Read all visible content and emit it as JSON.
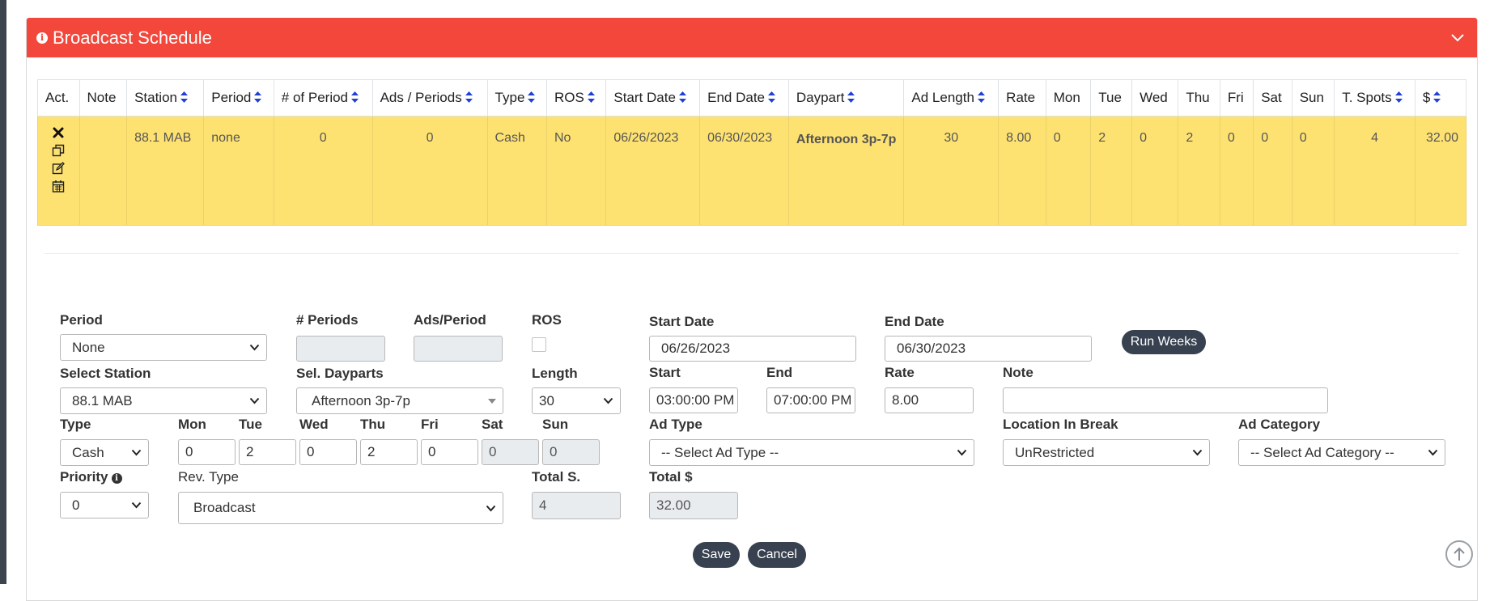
{
  "panel": {
    "title": "Broadcast Schedule"
  },
  "table": {
    "headers": [
      "Act.",
      "Note",
      "Station",
      "Period",
      "# of Period",
      "Ads / Periods",
      "Type",
      "ROS",
      "Start Date",
      "End Date",
      "Daypart",
      "Ad Length",
      "Rate",
      "Mon",
      "Tue",
      "Wed",
      "Thu",
      "Fri",
      "Sat",
      "Sun",
      "T. Spots",
      "$"
    ],
    "row": {
      "note": "",
      "station": "88.1 MAB",
      "period": "none",
      "num_period": "0",
      "ads_periods": "0",
      "type": "Cash",
      "ros": "No",
      "start_date": "06/26/2023",
      "end_date": "06/30/2023",
      "daypart": "Afternoon 3p-7p",
      "ad_length": "30",
      "rate": "8.00",
      "mon": "0",
      "tue": "2",
      "wed": "0",
      "thu": "2",
      "fri": "0",
      "sat": "0",
      "sun": "0",
      "t_spots": "4",
      "amount": "32.00"
    }
  },
  "form": {
    "labels": {
      "period": "Period",
      "num_periods": "# Periods",
      "ads_period": "Ads/Period",
      "ros": "ROS",
      "start_date": "Start Date",
      "end_date": "End Date",
      "select_station": "Select Station",
      "sel_dayparts": "Sel. Dayparts",
      "length": "Length",
      "start": "Start",
      "end": "End",
      "rate": "Rate",
      "note": "Note",
      "type": "Type",
      "mon": "Mon",
      "tue": "Tue",
      "wed": "Wed",
      "thu": "Thu",
      "fri": "Fri",
      "sat": "Sat",
      "sun": "Sun",
      "ad_type": "Ad Type",
      "location_in_break": "Location In Break",
      "ad_category": "Ad Category",
      "priority": "Priority",
      "rev_type": "Rev. Type",
      "total_s": "Total S.",
      "total_amount": "Total $"
    },
    "values": {
      "period": "None",
      "num_periods": "",
      "ads_period": "",
      "start_date": "06/26/2023",
      "end_date": "06/30/2023",
      "station": "88.1 MAB",
      "dayparts": "Afternoon 3p-7p",
      "length": "30",
      "start_time": "03:00:00 PM",
      "end_time": "07:00:00 PM",
      "rate": "8.00",
      "note": "",
      "type": "Cash",
      "mon": "0",
      "tue": "2",
      "wed": "0",
      "thu": "2",
      "fri": "0",
      "sat": "0",
      "sun": "0",
      "ad_type": "-- Select Ad Type --",
      "location_in_break": "UnRestricted",
      "ad_category": "-- Select Ad Category --",
      "priority": "0",
      "rev_type": "Broadcast",
      "total_s": "4",
      "total_amount": "32.00"
    },
    "buttons": {
      "run_weeks": "Run Weeks",
      "save": "Save",
      "cancel": "Cancel"
    }
  },
  "colors": {
    "header": "#f2473a",
    "row_highlight": "#fee271",
    "dark_button": "#37414f",
    "sort_arrow": "#1f3fd6"
  }
}
